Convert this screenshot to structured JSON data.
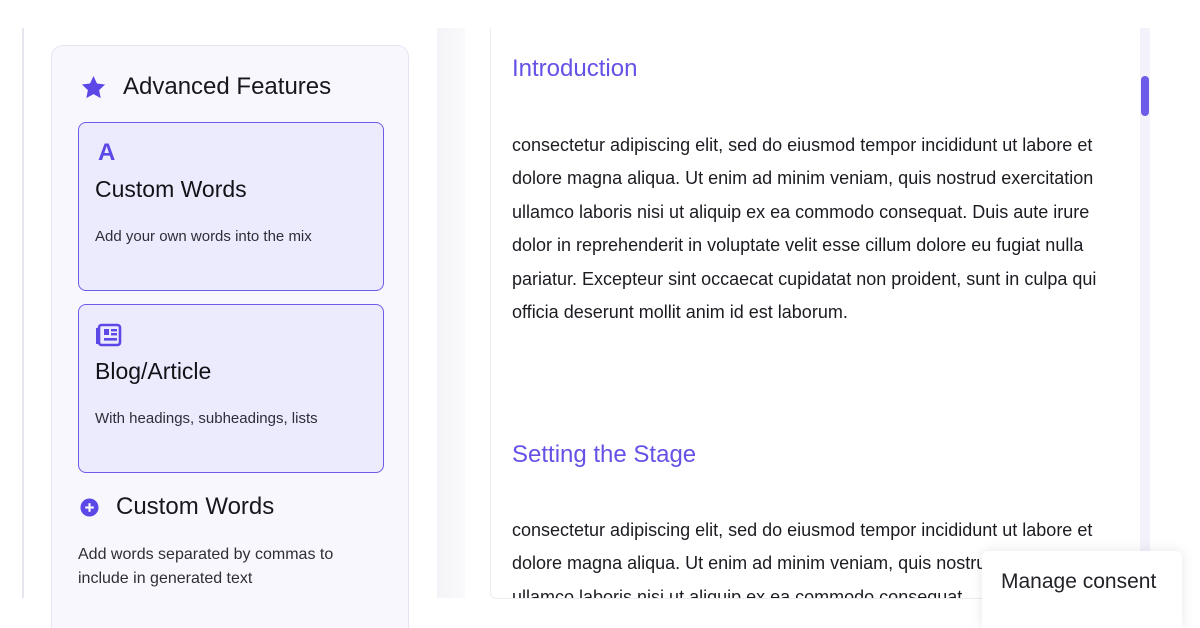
{
  "sidebar": {
    "advanced_title": "Advanced Features",
    "cards": [
      {
        "icon": "letter-a-icon",
        "title": "Custom Words",
        "description": "Add your own words into the mix"
      },
      {
        "icon": "article-icon",
        "title": "Blog/Article",
        "description": "With headings, subheadings, lists"
      }
    ],
    "custom_words": {
      "title": "Custom Words",
      "icon": "plus-circle-icon",
      "description": "Add words separated by commas to include in generated text"
    }
  },
  "content": {
    "sections": [
      {
        "heading": "Introduction",
        "paragraph": "consectetur adipiscing elit, sed do eiusmod tempor incididunt ut labore et dolore magna aliqua. Ut enim ad minim veniam, quis nostrud exercitation ullamco laboris nisi ut aliquip ex ea commodo consequat. Duis aute irure dolor in reprehenderit in voluptate velit esse cillum dolore eu fugiat nulla pariatur. Excepteur sint occaecat cupidatat non proident, sunt in culpa qui officia deserunt mollit anim id est laborum."
      },
      {
        "heading": "Setting the Stage",
        "paragraph": "consectetur adipiscing elit, sed do eiusmod tempor incididunt ut labore et dolore magna aliqua. Ut enim ad minim veniam, quis nostrud exercitation ullamco laboris nisi ut aliquip ex ea commodo consequat."
      }
    ]
  },
  "consent": {
    "label": "Manage consent"
  },
  "colors": {
    "accent": "#6d5ce8",
    "heading": "#6452e6",
    "card_background": "#ecebfd",
    "sidebar_background": "#f8f7fe"
  },
  "icons": {
    "advanced_features": "star-icon"
  }
}
